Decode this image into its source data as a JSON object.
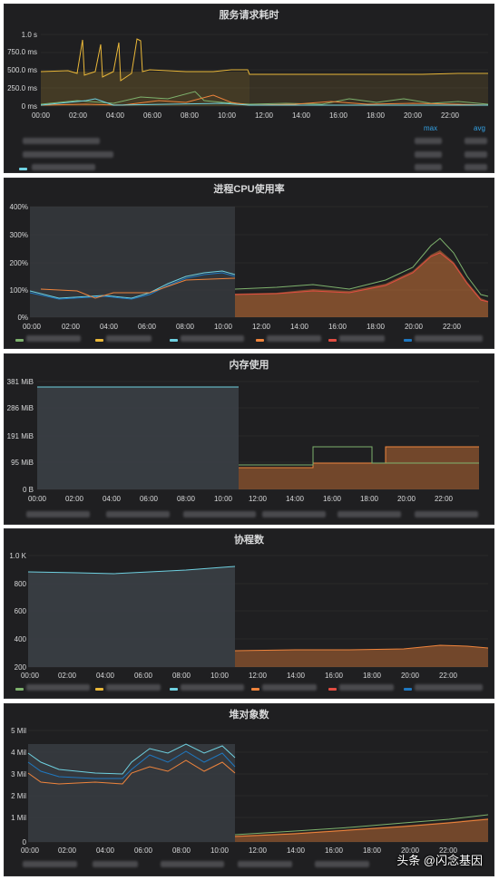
{
  "panels": [
    {
      "title": "服务请求耗时",
      "y_ticks": [
        "1.0 s",
        "750.0 ms",
        "500.0 ms",
        "250.0 ms",
        "0 ms"
      ],
      "legend_headers": {
        "max": "max",
        "avg": "avg"
      }
    },
    {
      "title": "进程CPU使用率",
      "y_ticks": [
        "400%",
        "300%",
        "200%",
        "100%",
        "0%"
      ]
    },
    {
      "title": "内存使用",
      "y_ticks": [
        "381 MiB",
        "286 MiB",
        "191 MiB",
        "95 MiB",
        "0 B"
      ]
    },
    {
      "title": "协程数",
      "y_ticks": [
        "1.0 K",
        "800",
        "600",
        "400",
        "200"
      ]
    },
    {
      "title": "堆对象数",
      "y_ticks": [
        "5 Mil",
        "4 Mil",
        "3 Mil",
        "2 Mil",
        "1 Mil",
        "0"
      ]
    }
  ],
  "x_ticks": [
    "00:00",
    "02:00",
    "04:00",
    "06:00",
    "08:00",
    "10:00",
    "12:00",
    "14:00",
    "16:00",
    "18:00",
    "20:00",
    "22:00"
  ],
  "watermark": "头条 @闪念基因",
  "colors": {
    "green": "#7eb26d",
    "yellow": "#eab839",
    "blue": "#6ed0e0",
    "orange": "#ef843c",
    "red": "#e24d42",
    "navy": "#1f78c1",
    "gray": "#3a3f45"
  }
}
